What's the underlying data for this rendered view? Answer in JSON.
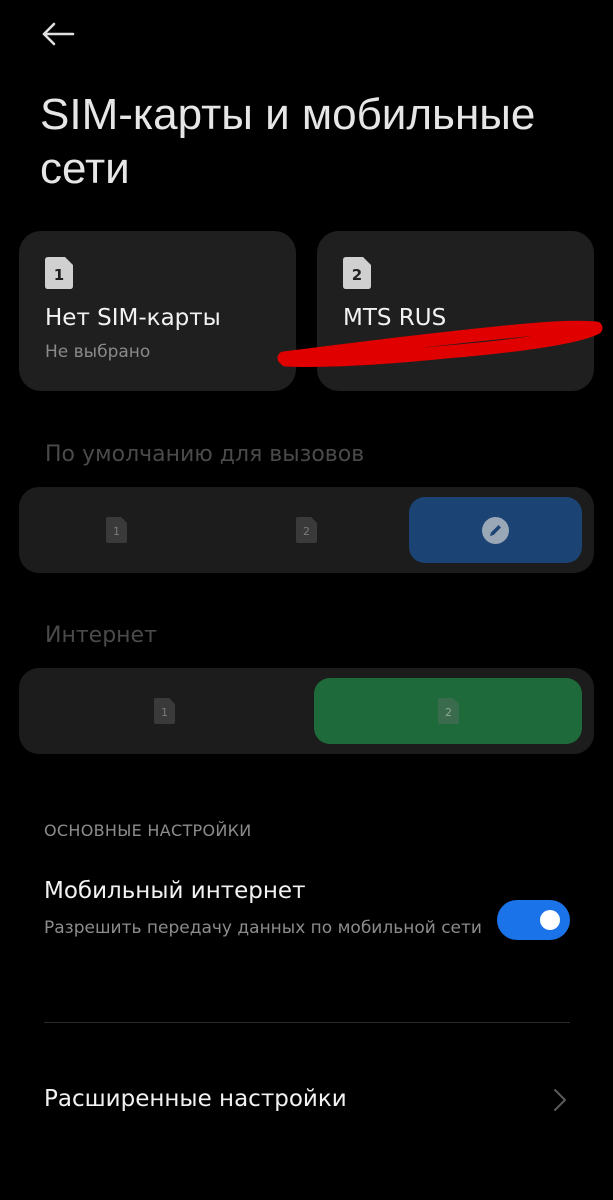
{
  "header": {
    "title": "SIM-карты и мобильные сети"
  },
  "sim_cards": [
    {
      "slot": "1",
      "name": "Нет SIM-карты",
      "status": "Не выбрано"
    },
    {
      "slot": "2",
      "name": "MTS RUS",
      "status": ""
    }
  ],
  "calls": {
    "label": "По умолчанию для вызовов",
    "options": [
      {
        "slot": "1",
        "icon": "sim-1-icon"
      },
      {
        "slot": "2",
        "icon": "sim-2-icon"
      },
      {
        "icon": "pencil-icon",
        "selected": true
      }
    ],
    "accent": "#1b4474"
  },
  "internet": {
    "label": "Интернет",
    "options": [
      {
        "slot": "1",
        "icon": "sim-1-icon"
      },
      {
        "slot": "2",
        "icon": "sim-2-icon",
        "selected": true
      }
    ],
    "accent": "#1e6a3b"
  },
  "basic_settings": {
    "header": "ОСНОВНЫЕ НАСТРОЙКИ",
    "mobile_internet": {
      "title": "Мобильный интернет",
      "subtitle": "Разрешить передачу данных по мобильной сети",
      "enabled": true,
      "toggle_color": "#1a73e8"
    }
  },
  "advanced": {
    "label": "Расширенные настройки"
  },
  "icons": {
    "back": "back-arrow-icon",
    "chevron": "chevron-right-icon"
  }
}
